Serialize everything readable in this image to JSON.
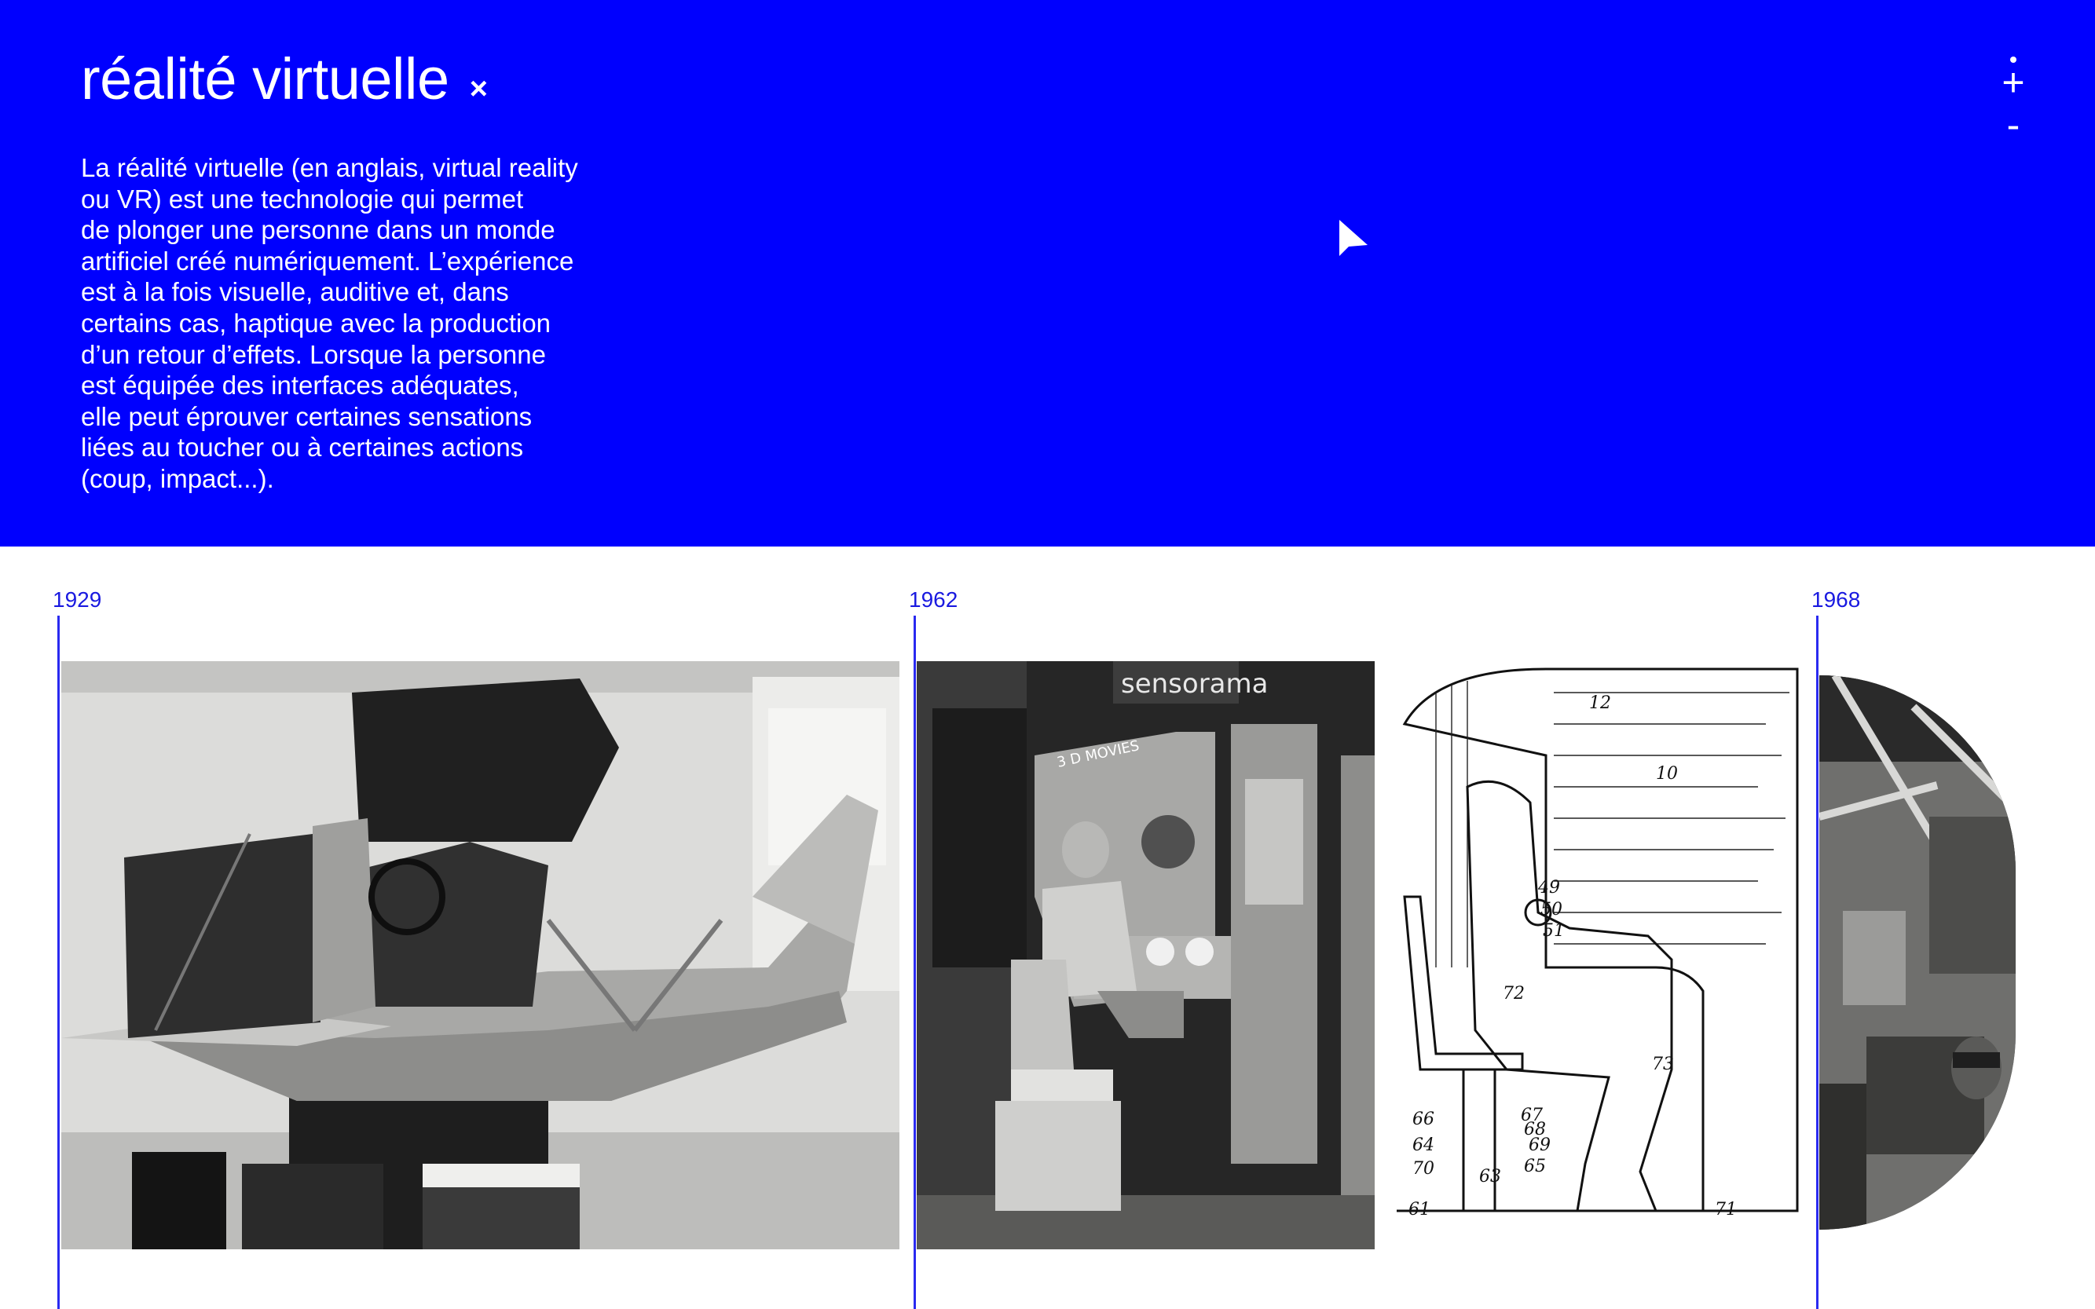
{
  "header": {
    "title": "réalité virtuelle",
    "close_label": "×",
    "description": "La réalité virtuelle (en anglais, virtual reality\nou VR) est une technologie qui permet\nde plonger une personne dans un monde\nartificiel créé numériquement. L’expérience\nest à la fois visuelle, auditive et, dans\ncertains cas, haptique avec la production\nd’un retour d’effets. Lorsque la personne\nest équipée des interfaces adéquates,\nelle peut éprouver certaines sensations\nliées au toucher ou à certaines actions\n(coup, impact...).",
    "background_color": "#0000fe",
    "text_color": "#ffffff"
  },
  "zoom": {
    "plus_label": "+",
    "minus_label": "-"
  },
  "timeline": {
    "accent_color": "#1a1ae0",
    "markers": [
      {
        "year": "1929"
      },
      {
        "year": "1962"
      },
      {
        "year": "1968"
      }
    ],
    "images": [
      {
        "icon": "flight-simulator-photo"
      },
      {
        "icon": "sensorama-machine-photo",
        "sign_text": "sensorama",
        "panel_text": "3 D MOVIES"
      },
      {
        "icon": "sensorama-patent-drawing",
        "labels": [
          "12",
          "10",
          "49",
          "50",
          "51",
          "72",
          "73",
          "66",
          "67",
          "68",
          "64",
          "69",
          "70",
          "63",
          "65",
          "61",
          "71"
        ]
      },
      {
        "icon": "head-mounted-display-photo"
      }
    ]
  }
}
